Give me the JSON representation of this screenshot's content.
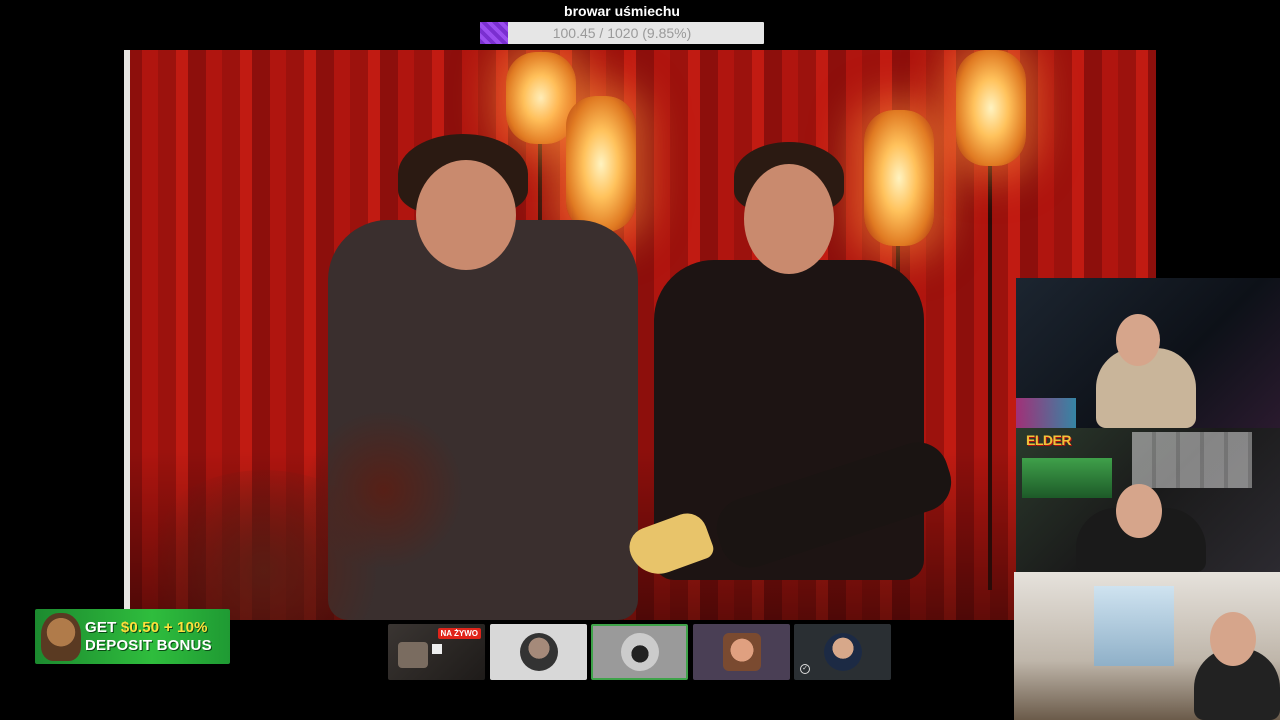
{
  "goal": {
    "title": "browar uśmiechu",
    "progress_text": "100.45 / 1020 (9.85%)",
    "progress_fraction": 0.0985,
    "fill_color": "#8a3ee0"
  },
  "promo": {
    "line1_prefix": "GET ",
    "line1_amount": "$0.50",
    "line1_suffix": " + 10%",
    "line2": "DEPOSIT BONUS"
  },
  "participants": [
    {
      "badge": "NA ŻYWO"
    },
    {},
    {},
    {},
    {}
  ],
  "webcams": {
    "cam2_brand": "ELDER"
  }
}
